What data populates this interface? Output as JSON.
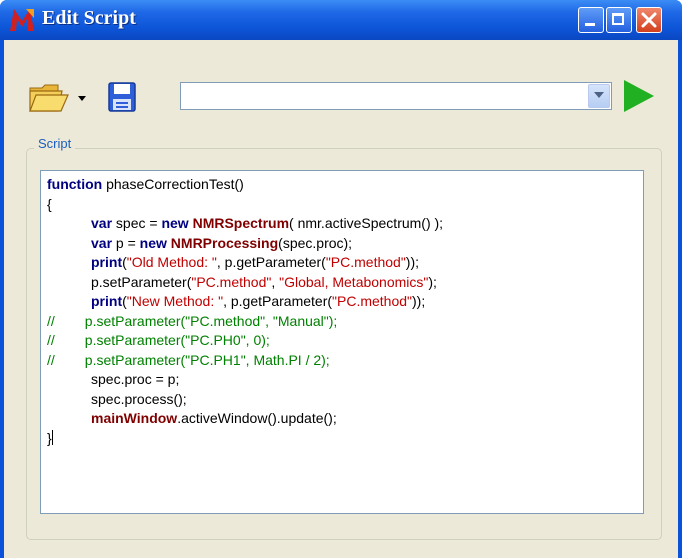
{
  "window": {
    "title": "Edit Script"
  },
  "toolbar": {
    "open_icon": "folder-open-icon",
    "save_icon": "floppy-disk-icon",
    "run_icon": "play-icon",
    "combo_value": ""
  },
  "group": {
    "label": "Script"
  },
  "code": [
    {
      "type": "plain",
      "parts": [
        {
          "c": "kw",
          "t": "function"
        },
        {
          "c": "",
          "t": " phaseCorrectionTest()"
        }
      ]
    },
    {
      "type": "plain",
      "parts": [
        {
          "c": "",
          "t": "{"
        }
      ]
    },
    {
      "type": "indent",
      "parts": [
        {
          "c": "kw",
          "t": "var"
        },
        {
          "c": "",
          "t": " spec = "
        },
        {
          "c": "kw",
          "t": "new"
        },
        {
          "c": "",
          "t": " "
        },
        {
          "c": "cls",
          "t": "NMRSpectrum"
        },
        {
          "c": "",
          "t": "( nmr.activeSpectrum() );"
        }
      ]
    },
    {
      "type": "indent",
      "parts": [
        {
          "c": "kw",
          "t": "var"
        },
        {
          "c": "",
          "t": " p = "
        },
        {
          "c": "kw",
          "t": "new"
        },
        {
          "c": "",
          "t": " "
        },
        {
          "c": "cls",
          "t": "NMRProcessing"
        },
        {
          "c": "",
          "t": "(spec.proc);"
        }
      ]
    },
    {
      "type": "indent",
      "parts": [
        {
          "c": "kw",
          "t": "print"
        },
        {
          "c": "",
          "t": "("
        },
        {
          "c": "str",
          "t": "\"Old Method: \""
        },
        {
          "c": "",
          "t": ", p.getParameter("
        },
        {
          "c": "str",
          "t": "\"PC.method\""
        },
        {
          "c": "",
          "t": "));"
        }
      ]
    },
    {
      "type": "indent",
      "parts": [
        {
          "c": "",
          "t": "p.setParameter("
        },
        {
          "c": "str",
          "t": "\"PC.method\""
        },
        {
          "c": "",
          "t": ", "
        },
        {
          "c": "str",
          "t": "\"Global, Metabonomics\""
        },
        {
          "c": "",
          "t": ");"
        }
      ]
    },
    {
      "type": "indent",
      "parts": [
        {
          "c": "kw",
          "t": "print"
        },
        {
          "c": "",
          "t": "("
        },
        {
          "c": "str",
          "t": "\"New Method: \""
        },
        {
          "c": "",
          "t": ", p.getParameter("
        },
        {
          "c": "str",
          "t": "\"PC.method\""
        },
        {
          "c": "",
          "t": "));"
        }
      ]
    },
    {
      "type": "comment",
      "parts": [
        {
          "c": "cm",
          "t": "//"
        },
        {
          "c": "cm-gap",
          "t": ""
        },
        {
          "c": "cm",
          "t": "p.setParameter(\"PC.method\", \"Manual\");"
        }
      ]
    },
    {
      "type": "comment",
      "parts": [
        {
          "c": "cm",
          "t": "//"
        },
        {
          "c": "cm-gap",
          "t": ""
        },
        {
          "c": "cm",
          "t": "p.setParameter(\"PC.PH0\", 0);"
        }
      ]
    },
    {
      "type": "comment",
      "parts": [
        {
          "c": "cm",
          "t": "//"
        },
        {
          "c": "cm-gap",
          "t": ""
        },
        {
          "c": "cm",
          "t": "p.setParameter(\"PC.PH1\", Math.PI / 2);"
        }
      ]
    },
    {
      "type": "indent",
      "parts": [
        {
          "c": "",
          "t": "spec.proc = p;"
        }
      ]
    },
    {
      "type": "indent",
      "parts": [
        {
          "c": "",
          "t": "spec.process();"
        }
      ]
    },
    {
      "type": "indent",
      "parts": [
        {
          "c": "cls",
          "t": "mainWindow"
        },
        {
          "c": "",
          "t": ".activeWindow().update();"
        }
      ]
    },
    {
      "type": "cursor",
      "parts": [
        {
          "c": "",
          "t": "}"
        }
      ]
    }
  ]
}
